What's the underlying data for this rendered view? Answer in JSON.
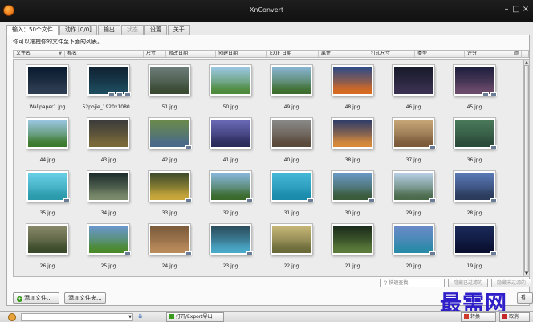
{
  "window": {
    "title": "XnConvert"
  },
  "tabs": [
    {
      "label": "输入：50个文件",
      "active": true,
      "disabled": false
    },
    {
      "label": "动作 [0/0]",
      "active": false,
      "disabled": false
    },
    {
      "label": "输出",
      "active": false,
      "disabled": false
    },
    {
      "label": "状态",
      "active": false,
      "disabled": true
    },
    {
      "label": "设置",
      "active": false,
      "disabled": false
    },
    {
      "label": "关于",
      "active": false,
      "disabled": false
    }
  ],
  "hint": "你可以拖拽你的文件至下面的列表。",
  "columns": [
    "文件名",
    "格名",
    "尺寸",
    "修改日期",
    "创建日期",
    "EXIF 日期",
    "属性",
    "打印尺寸",
    "类型",
    "评分",
    "颜"
  ],
  "files": [
    {
      "name": "Wallpaper1.jpg",
      "top": "#0a1a2e",
      "bottom": "#2e3d52",
      "badges": 0
    },
    {
      "name": "52pojie_1920x1080...",
      "top": "#0f2233",
      "bottom": "#1d4a5c",
      "badges": 3
    },
    {
      "name": "51.jpg",
      "top": "#6c7d7a",
      "bottom": "#3a4a32",
      "badges": 0
    },
    {
      "name": "50.jpg",
      "top": "#9ec9e8",
      "bottom": "#4d8a3a",
      "badges": 0
    },
    {
      "name": "49.jpg",
      "top": "#8bb6d6",
      "bottom": "#3d6e2e",
      "badges": 0
    },
    {
      "name": "48.jpg",
      "top": "#2a4a88",
      "bottom": "#d86a22",
      "badges": 0
    },
    {
      "name": "46.jpg",
      "top": "#161a2a",
      "bottom": "#3a3050",
      "badges": 0
    },
    {
      "name": "45.jpg",
      "top": "#1c1e3c",
      "bottom": "#6a4a6a",
      "badges": 2
    },
    {
      "name": "44.jpg",
      "top": "#9cc8e6",
      "bottom": "#3c7a2a",
      "badges": 0
    },
    {
      "name": "43.jpg",
      "top": "#3a3a3a",
      "bottom": "#7a6a3a",
      "badges": 0
    },
    {
      "name": "42.jpg",
      "top": "#6a8a4a",
      "bottom": "#4a6a8a",
      "badges": 1
    },
    {
      "name": "41.jpg",
      "top": "#6a6ab8",
      "bottom": "#2a2a5a",
      "badges": 0
    },
    {
      "name": "40.jpg",
      "top": "#8a8a8a",
      "bottom": "#5a4a3a",
      "badges": 0
    },
    {
      "name": "38.jpg",
      "top": "#2a3a6a",
      "bottom": "#d88a3a",
      "badges": 0
    },
    {
      "name": "37.jpg",
      "top": "#c8a878",
      "bottom": "#7a5a3a",
      "badges": 1
    },
    {
      "name": "36.jpg",
      "top": "#4a7a5a",
      "bottom": "#2a4a3a",
      "badges": 1
    },
    {
      "name": "35.jpg",
      "top": "#6ad0e8",
      "bottom": "#2a9aaa",
      "badges": 1
    },
    {
      "name": "34.jpg",
      "top": "#1a2a2a",
      "bottom": "#7a8a6a",
      "badges": 0
    },
    {
      "name": "33.jpg",
      "top": "#3a4a2a",
      "bottom": "#c8a83a",
      "badges": 1
    },
    {
      "name": "32.jpg",
      "top": "#8ab8e0",
      "bottom": "#3a6a2a",
      "badges": 1
    },
    {
      "name": "31.jpg",
      "top": "#48b8d8",
      "bottom": "#1a8aaa",
      "badges": 1
    },
    {
      "name": "30.jpg",
      "top": "#6a9ac8",
      "bottom": "#3a5a3a",
      "badges": 1
    },
    {
      "name": "29.jpg",
      "top": "#b8d0e8",
      "bottom": "#4a6a4a",
      "badges": 1
    },
    {
      "name": "28.jpg",
      "top": "#5a7ab8",
      "bottom": "#2a3a5a",
      "badges": 1
    },
    {
      "name": "26.jpg",
      "top": "#8a8a6a",
      "bottom": "#3a4a2a",
      "badges": 0
    },
    {
      "name": "25.jpg",
      "top": "#6a98d0",
      "bottom": "#4a8a2a",
      "badges": 1
    },
    {
      "name": "24.jpg",
      "top": "#7a5a3a",
      "bottom": "#b88a5a",
      "badges": 1
    },
    {
      "name": "23.jpg",
      "top": "#2a4a5a",
      "bottom": "#4aa8c8",
      "badges": 1
    },
    {
      "name": "22.jpg",
      "top": "#c8b878",
      "bottom": "#6a6a3a",
      "badges": 0
    },
    {
      "name": "21.jpg",
      "top": "#1a2a1a",
      "bottom": "#5a7a3a",
      "badges": 0
    },
    {
      "name": "20.jpg",
      "top": "#6a8ac8",
      "bottom": "#2a8aa8",
      "badges": 1
    },
    {
      "name": "19.jpg",
      "top": "#1a2a5a",
      "bottom": "#0a1030",
      "badges": 1
    }
  ],
  "filter": {
    "search_placeholder": "快速查找",
    "filter1_label": "隐藏已过滤的",
    "filter2_label": "隐藏未过滤的"
  },
  "actions": {
    "add_files": "添加文件...",
    "add_folder": "添加文件夹...",
    "partial": "看"
  },
  "watermark": "最需网",
  "statusbar": {
    "export_label": "打开/Export导出",
    "convert_label": "转换",
    "cancel_label": "取消"
  }
}
